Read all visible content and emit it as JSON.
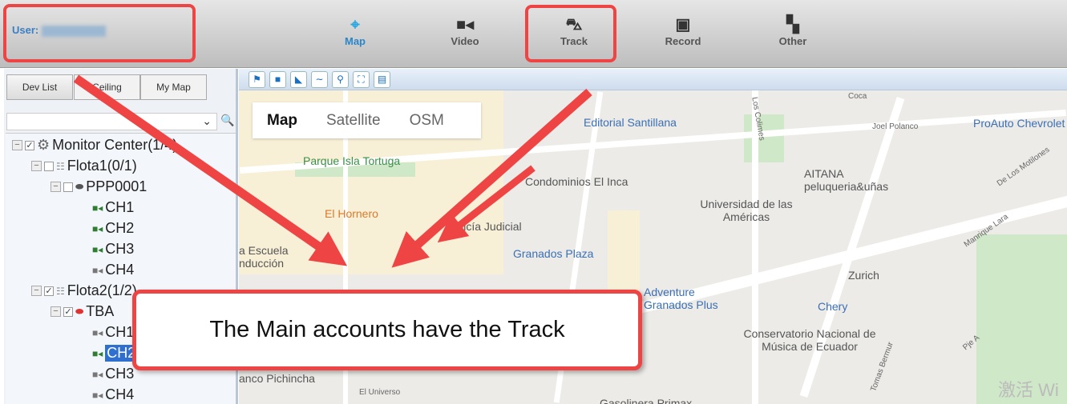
{
  "header": {
    "user_label": "User:",
    "nav": [
      {
        "label": "Map",
        "icon": "map-pin-icon",
        "active": true
      },
      {
        "label": "Video",
        "icon": "video-camera-icon"
      },
      {
        "label": "Track",
        "icon": "car-icon"
      },
      {
        "label": "Record",
        "icon": "film-icon"
      },
      {
        "label": "Other",
        "icon": "grid-icon"
      }
    ]
  },
  "sidebar": {
    "tabs": [
      "Dev List",
      "Ceiling",
      "My Map"
    ],
    "tree": [
      {
        "label": "Monitor Center(1/4)",
        "checked": true
      },
      {
        "label": "Flota1(0/1)",
        "checked": false
      },
      {
        "label": "PPP0001",
        "checked": false
      },
      {
        "label": "CH1",
        "online": true
      },
      {
        "label": "CH2",
        "online": true
      },
      {
        "label": "CH3",
        "online": true
      },
      {
        "label": "CH4",
        "online": false
      },
      {
        "label": "Flota2(1/2)",
        "checked": true
      },
      {
        "label": "TBA",
        "checked": true
      },
      {
        "label": "CH1",
        "online": false
      },
      {
        "label": "CH2",
        "online": true,
        "selected": true
      },
      {
        "label": "CH3",
        "online": false
      },
      {
        "label": "CH4",
        "online": false
      }
    ]
  },
  "map": {
    "types": [
      "Map",
      "Satellite",
      "OSM"
    ],
    "labels": [
      "Editorial Santillana",
      "ProAuto Chevrolet - Matriz",
      "Parque Isla Tortuga",
      "Condominios El Inca",
      "AITANA peluqueria&uñas",
      "Universidad de las Américas",
      "El Hornero",
      "Policía Judicial",
      "Granados Plaza",
      "a Escuela nducción",
      "Adventure Granados Plus",
      "Zurich",
      "Chery",
      "Conservatorio Nacional de Música de Ecuador",
      "anco Pichincha",
      "Gasolinera Primax",
      "Joel Polanco",
      "De Los Motilones",
      "Manrique Lara",
      "Pje A",
      "El Universo",
      "Tomas Bermur",
      "Coca",
      "Los Colimes"
    ]
  },
  "callout": {
    "text": "The Main accounts have the Track"
  },
  "watermark": "激活 Wi",
  "colors": {
    "highlight": "#ef4444",
    "accent": "#2a86c9"
  }
}
